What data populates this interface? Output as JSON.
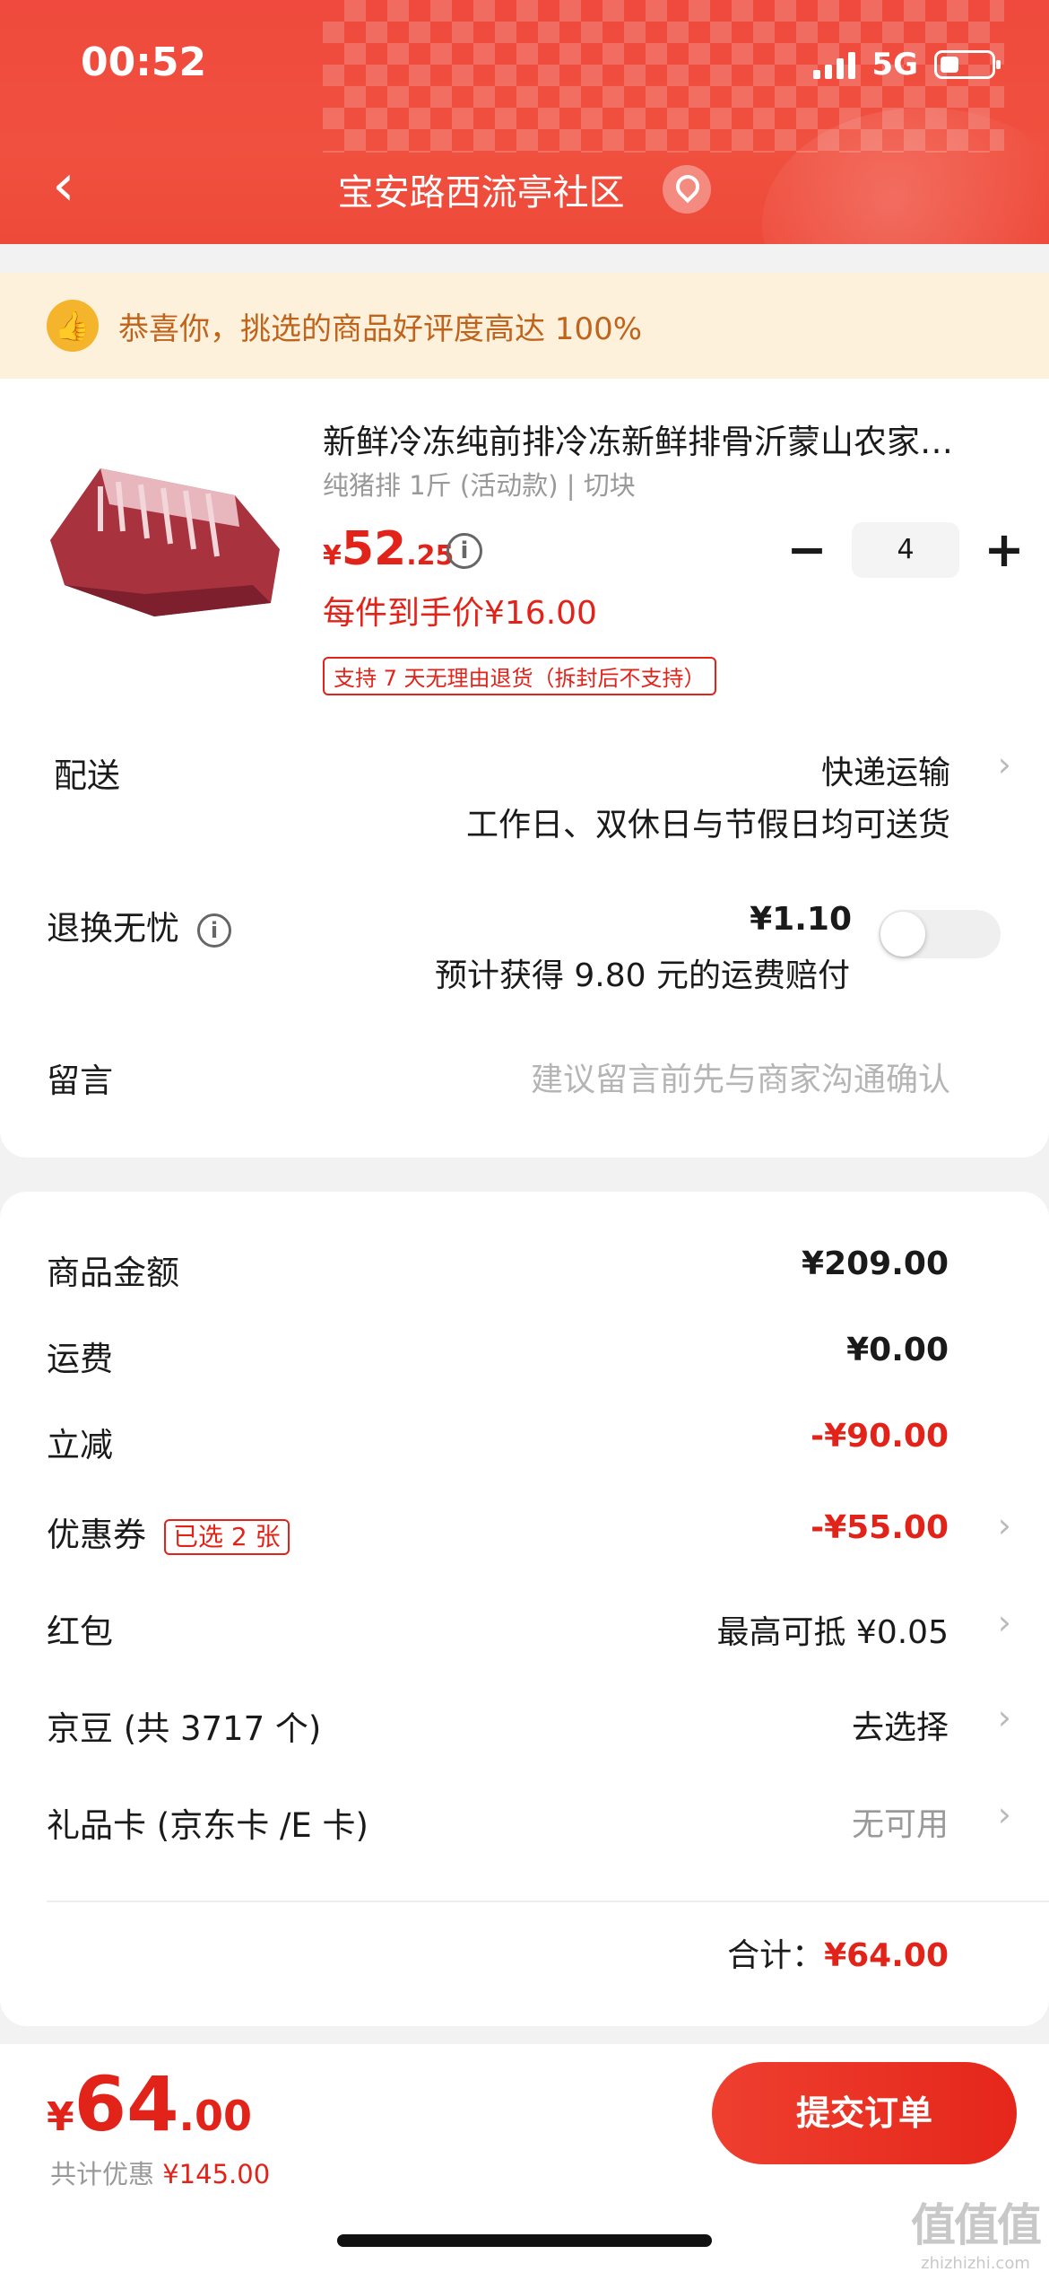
{
  "status_bar": {
    "time": "00:52",
    "network": "5G"
  },
  "nav": {
    "title": "宝安路西流亭社区"
  },
  "banner": {
    "text": "恭喜你，挑选的商品好评度高达 100%"
  },
  "product": {
    "title": "新鲜冷冻纯前排冷冻新鲜排骨沂蒙山农家…",
    "spec": "纯猪排 1斤 (活动款) | 切块",
    "price_yen": "¥",
    "price_int": "52",
    "price_dec": ".25",
    "quantity": "4",
    "minus": "−",
    "plus": "+",
    "each_price": "每件到手价¥16.00",
    "return_tag": "支持 7 天无理由退货（拆封后不支持）"
  },
  "delivery": {
    "label": "配送",
    "method": "快递运输",
    "note": "工作日、双休日与节假日均可送货"
  },
  "return_service": {
    "label": "退换无忧",
    "price": "¥1.10",
    "note": "预计获得 9.80 元的运费赔付",
    "enabled": false
  },
  "message": {
    "label": "留言",
    "placeholder": "建议留言前先与商家沟通确认"
  },
  "summary": {
    "goods_label": "商品金额",
    "goods_value": "¥209.00",
    "shipping_label": "运费",
    "shipping_value": "¥0.00",
    "discount_label": "立减",
    "discount_value": "-¥90.00",
    "coupon_label": "优惠券",
    "coupon_tag": "已选 2 张",
    "coupon_value": "-¥55.00",
    "redpacket_label": "红包",
    "redpacket_value": "最高可抵 ¥0.05",
    "jingdou_label": "京豆 (共 3717 个)",
    "jingdou_value": "去选择",
    "giftcard_label": "礼品卡 (京东卡 /E 卡)",
    "giftcard_value": "无可用",
    "total_label": "合计：",
    "total_value": "¥64.00"
  },
  "bottom": {
    "yen": "¥",
    "int": "64",
    "dec": ".00",
    "saved_label": "共计优惠 ",
    "saved_value": "¥145.00",
    "submit_label": "提交订单"
  },
  "watermark": {
    "big": "值值值",
    "small": "zhizhizhi.com"
  },
  "colors": {
    "brand_red": "#e2231a",
    "header_red": "#ef4a3d",
    "banner_bg": "#fdf1dc"
  }
}
